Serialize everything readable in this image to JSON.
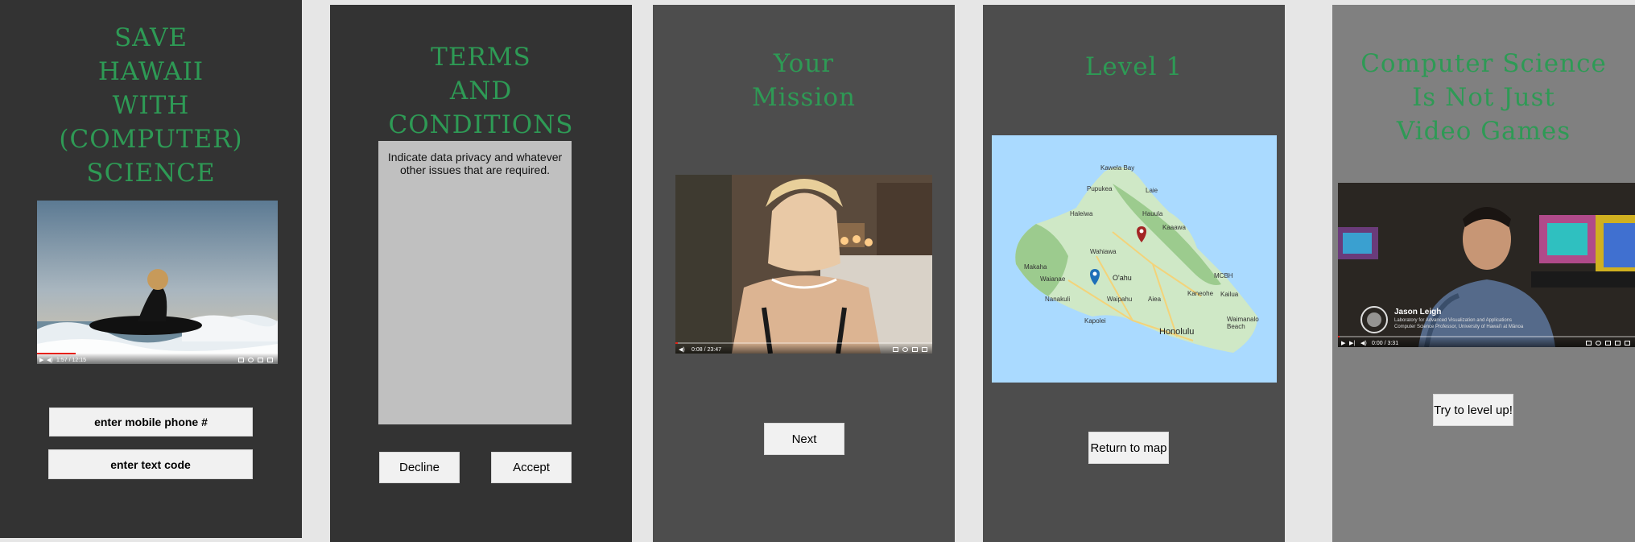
{
  "colors": {
    "page_bg": "#e6e6e6",
    "screen_dark": "#333333",
    "screen_medium": "#4d4d4d",
    "screen_gray": "#808080",
    "title_green": "#2e9a55",
    "button_bg": "#f1f1f1",
    "terms_box": "#c0c0c0",
    "map_water": "#aadaff"
  },
  "screens": {
    "save_hawaii": {
      "title": "SAVE\nHAWAII\nWITH\n(COMPUTER)\nSCIENCE",
      "video": {
        "time": "1:57 / 12:15",
        "progress": 0.16
      },
      "phone_button": "enter mobile phone #",
      "code_button": "enter text code"
    },
    "terms": {
      "title": "TERMS\nAND\nCONDITIONS",
      "body_text": "Indicate data privacy and whatever other issues that are required.",
      "decline_button": "Decline",
      "accept_button": "Accept"
    },
    "mission": {
      "title": "Your\nMission",
      "video": {
        "time": "0:08 / 23:47",
        "progress": 0.0
      },
      "next_button": "Next"
    },
    "level1": {
      "title": "Level 1",
      "map": {
        "labels": [
          "Kawela Bay",
          "Pupukea",
          "Laie",
          "Hauula",
          "Haleiwa",
          "Kaaawa",
          "Wahiawa",
          "Makaha",
          "O'ahu",
          "Waianae",
          "Kaneohe",
          "MCBH",
          "Nanakuli",
          "Waipahu",
          "Aiea",
          "Kailua",
          "Kapolei",
          "Honolulu",
          "Waimanalo Beach"
        ]
      },
      "return_button": "Return to map"
    },
    "cs_not_games": {
      "title": "Computer Science\nIs Not Just\nVideo Games",
      "video": {
        "name": "Jason Leigh",
        "subtitle_line1": "Laboratory for Advanced Visualization and Applications",
        "subtitle_line2": "Computer Science Professor, University of Hawai'i at Mānoa",
        "time": "0:00 / 3:31",
        "progress": 0.0
      },
      "levelup_button": "Try to level up!"
    }
  }
}
